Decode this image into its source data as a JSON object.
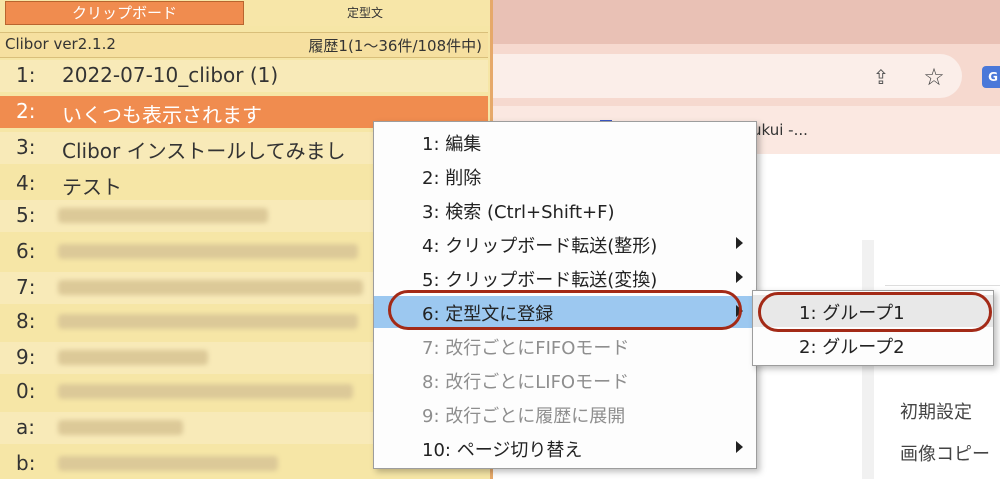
{
  "background": {
    "bookmark_text": "ukui -...",
    "google_icon_letter": "G",
    "side_items": [
      "初期設定",
      "画像コピー"
    ]
  },
  "clibor": {
    "tabs": [
      "クリップボード",
      "定型文"
    ],
    "version": "Clibor ver2.1.2",
    "history_status": "履歴1(1〜36件/108件中)",
    "items": [
      {
        "key": "1:",
        "text": "2022-07-10_clibor (1)"
      },
      {
        "key": "2:",
        "text": "いくつも表示されます"
      },
      {
        "key": "3:",
        "text": "Clibor インストールしてみまし"
      },
      {
        "key": "4:",
        "text": "テスト"
      },
      {
        "key": "5:",
        "text": ""
      },
      {
        "key": "6:",
        "text": ""
      },
      {
        "key": "7:",
        "text": ""
      },
      {
        "key": "8:",
        "text": ""
      },
      {
        "key": "9:",
        "text": ""
      },
      {
        "key": "0:",
        "text": ""
      },
      {
        "key": "a:",
        "text": ""
      },
      {
        "key": "b:",
        "text": ""
      }
    ]
  },
  "context_menu": {
    "items": [
      {
        "label": "1: 編集"
      },
      {
        "label": "2: 削除"
      },
      {
        "label": "3: 検索 (Ctrl+Shift+F)"
      },
      {
        "label": "4: クリップボード転送(整形)"
      },
      {
        "label": "5: クリップボード転送(変換)"
      },
      {
        "label": "6: 定型文に登録"
      },
      {
        "label": "7: 改行ごとにFIFOモード"
      },
      {
        "label": "8: 改行ごとにLIFOモード"
      },
      {
        "label": "9: 改行ごとに履歴に展開"
      },
      {
        "label": "10: ページ切り替え"
      }
    ]
  },
  "submenu": {
    "items": [
      {
        "label": "1: グループ1"
      },
      {
        "label": "2: グループ2"
      }
    ]
  },
  "colors": {
    "clibor_bg": "#f6e6a6",
    "selected_row": "#f08c4f",
    "menu_highlight": "#9cc8f0",
    "annotation_ring": "#a32a17"
  }
}
